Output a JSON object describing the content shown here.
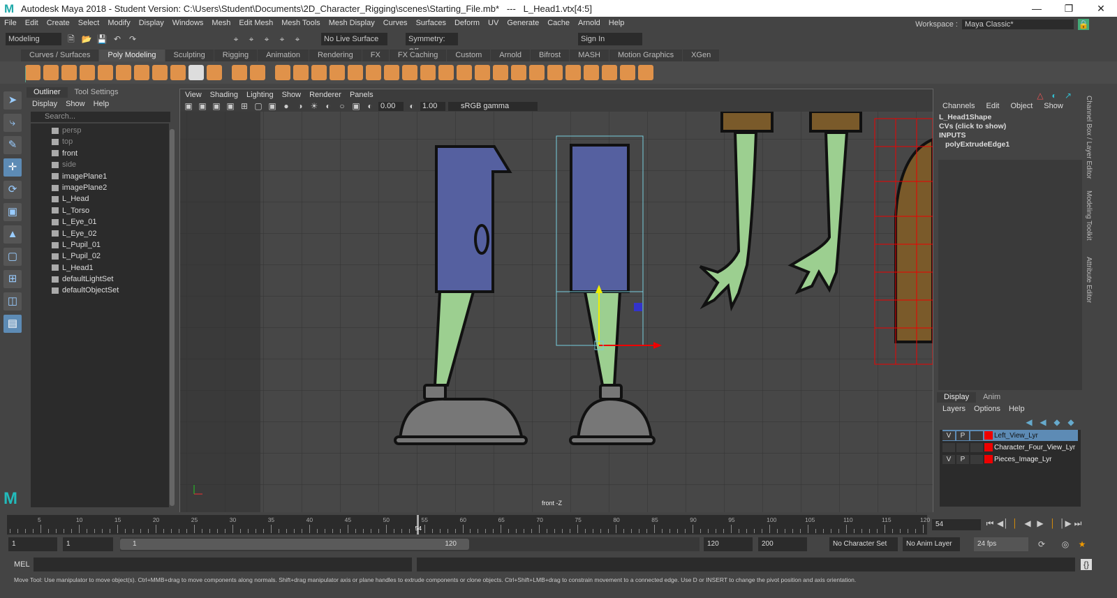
{
  "title": {
    "text": "Autodesk Maya 2018 - Student Version: C:\\Users\\Student\\Documents\\2D_Character_Rigging\\scenes\\Starting_File.mb*   ---   L_Head1.vtx[4:5]"
  },
  "menu": [
    "File",
    "Edit",
    "Create",
    "Select",
    "Modify",
    "Display",
    "Windows",
    "Mesh",
    "Edit Mesh",
    "Mesh Tools",
    "Mesh Display",
    "Curves",
    "Surfaces",
    "Deform",
    "UV",
    "Generate",
    "Cache",
    "Arnold",
    "Help"
  ],
  "workspace": {
    "label": "Workspace :",
    "value": "Maya Classic*"
  },
  "status": {
    "mode": "Modeling",
    "live": "No Live Surface",
    "symmetry": "Symmetry: Off",
    "signin": "Sign In"
  },
  "shelf_tabs": [
    "Curves / Surfaces",
    "Poly Modeling",
    "Sculpting",
    "Rigging",
    "Animation",
    "Rendering",
    "FX",
    "FX Caching",
    "Custom",
    "Arnold",
    "Bifrost",
    "MASH",
    "Motion Graphics",
    "XGen"
  ],
  "outliner": {
    "tabs": [
      "Outliner",
      "Tool Settings"
    ],
    "menu": [
      "Display",
      "Show",
      "Help"
    ],
    "search": "Search...",
    "items": [
      {
        "label": "persp",
        "dim": true
      },
      {
        "label": "top",
        "dim": true
      },
      {
        "label": "front",
        "dim": false
      },
      {
        "label": "side",
        "dim": true
      },
      {
        "label": "imagePlane1"
      },
      {
        "label": "imagePlane2"
      },
      {
        "label": "L_Head"
      },
      {
        "label": "L_Torso"
      },
      {
        "label": "L_Eye_01"
      },
      {
        "label": "L_Eye_02"
      },
      {
        "label": "L_Pupil_01"
      },
      {
        "label": "L_Pupil_02"
      },
      {
        "label": "L_Head1"
      },
      {
        "label": "defaultLightSet"
      },
      {
        "label": "defaultObjectSet"
      }
    ]
  },
  "viewport": {
    "menu": [
      "View",
      "Shading",
      "Lighting",
      "Show",
      "Renderer",
      "Panels"
    ],
    "exposure": "0.00",
    "gamma": "1.00",
    "colorspace": "sRGB gamma",
    "camera": "front -Z"
  },
  "channelbox": {
    "menu": [
      "Channels",
      "Edit",
      "Object",
      "Show"
    ],
    "shape": "L_Head1Shape",
    "cvs": "CVs (click to show)",
    "inputs": "INPUTS",
    "node": "polyExtrudeEdge1"
  },
  "layers": {
    "tabs": [
      "Display",
      "Anim"
    ],
    "menu": [
      "Layers",
      "Options",
      "Help"
    ],
    "rows": [
      {
        "v": "V",
        "p": "P",
        "name": "Left_View_Lyr",
        "selected": true
      },
      {
        "v": "",
        "p": "",
        "name": "Character_Four_View_Lyr",
        "selected": false
      },
      {
        "v": "V",
        "p": "P",
        "name": "Pieces_Image_Lyr",
        "selected": false
      }
    ]
  },
  "side_tabs": [
    "Channel Box / Layer Editor",
    "Modeling Toolkit",
    "Attribute Editor"
  ],
  "timeline": {
    "ticks": [
      "5",
      "10",
      "15",
      "20",
      "25",
      "30",
      "35",
      "40",
      "45",
      "50",
      "55",
      "60",
      "65",
      "70",
      "75",
      "80",
      "85",
      "90",
      "95",
      "100",
      "105",
      "110",
      "115",
      "120"
    ],
    "current": "54",
    "current_field": "54"
  },
  "range": {
    "start": "1",
    "anim_start": "1",
    "slider_start": "1",
    "slider_end": "120",
    "anim_end": "120",
    "end": "200",
    "character": "No Character Set",
    "anim_layer": "No Anim Layer",
    "fps": "24 fps"
  },
  "mel": {
    "label": "MEL"
  },
  "help": "Move Tool: Use manipulator to move object(s). Ctrl+MMB+drag to move components along normals. Shift+drag manipulator axis or plane handles to extrude components or clone objects. Ctrl+Shift+LMB+drag to constrain movement to a connected edge. Use D or INSERT to change the pivot position and axis orientation."
}
